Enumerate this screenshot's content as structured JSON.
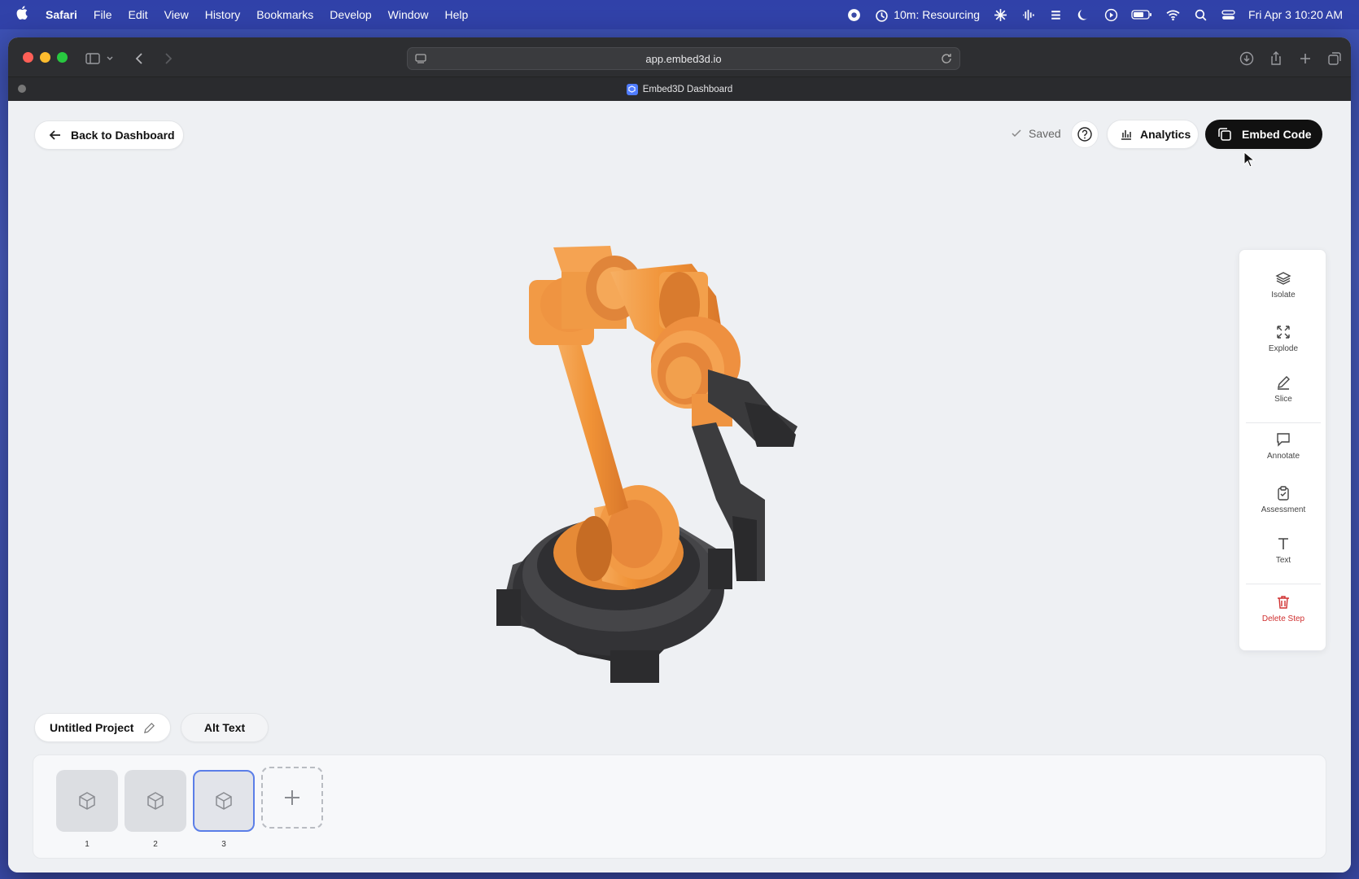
{
  "menubar": {
    "app": "Safari",
    "items": [
      "File",
      "Edit",
      "View",
      "History",
      "Bookmarks",
      "Develop",
      "Window",
      "Help"
    ],
    "status_timer": "10m: Resourcing",
    "clock": "Fri Apr 3  10:20 AM"
  },
  "browser": {
    "url": "app.embed3d.io",
    "tab_title": "Embed3D Dashboard"
  },
  "header": {
    "back_label": "Back to Dashboard",
    "saved_label": "Saved",
    "analytics_label": "Analytics",
    "embed_label": "Embed Code"
  },
  "tools": {
    "isolate": "Isolate",
    "explode": "Explode",
    "slice": "Slice",
    "annotate": "Annotate",
    "assessment": "Assessment",
    "text": "Text",
    "delete": "Delete Step"
  },
  "project": {
    "name": "Untitled Project",
    "alt_text_label": "Alt Text"
  },
  "steps": [
    {
      "label": "1"
    },
    {
      "label": "2"
    },
    {
      "label": "3"
    }
  ],
  "colors": {
    "accent_dark": "#111111",
    "active_step_border": "#5b7ee8",
    "danger": "#d03030",
    "robot_orange": "#f0993f",
    "robot_dark": "#3a3a3c"
  }
}
